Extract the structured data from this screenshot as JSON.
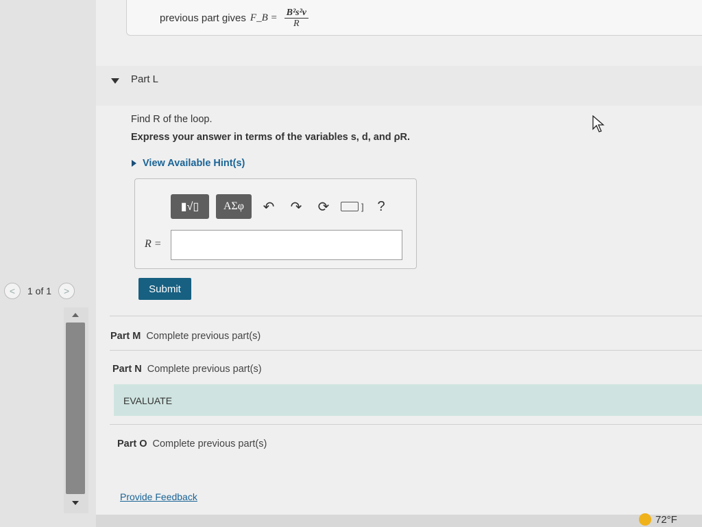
{
  "pager": {
    "label": "1 of 1",
    "prev": "<",
    "next": ">"
  },
  "previous_part": {
    "prefix": "previous part gives",
    "lhs": "F_B =",
    "num": "B²s²v",
    "den": "R"
  },
  "part_l": {
    "title": "Part L",
    "question": "Find R of the loop.",
    "instruction": "Express your answer in terms of the variables s, d, and ρR.",
    "hint_link": "View Available Hint(s)",
    "toolbar": {
      "templates": "▮√▯",
      "greek": "ΑΣφ",
      "undo": "↶",
      "redo": "↷",
      "reset": "⟳",
      "help": "?"
    },
    "answer_label": "R =",
    "answer_value": "",
    "submit": "Submit"
  },
  "part_m": {
    "label": "Part M",
    "status": "Complete previous part(s)"
  },
  "part_n": {
    "label": "Part N",
    "status": "Complete previous part(s)"
  },
  "evaluate": "EVALUATE",
  "part_o": {
    "label": "Part O",
    "status": "Complete previous part(s)"
  },
  "feedback": "Provide Feedback",
  "weather": "72°F",
  "colors": {
    "submit_bg": "#176081",
    "link": "#1a6496",
    "evaluate_bg": "#cfe4e0"
  }
}
